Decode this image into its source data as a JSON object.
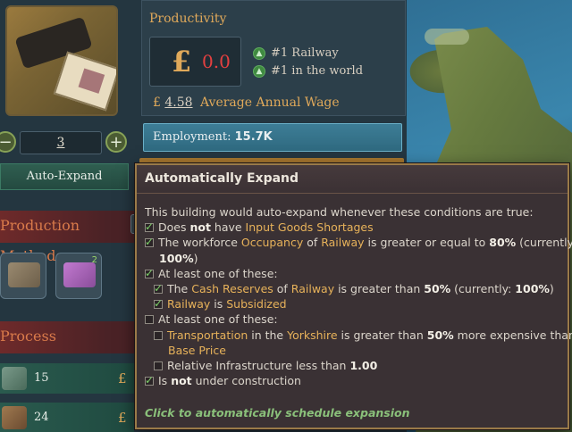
{
  "productivity": {
    "title": "Productivity",
    "currency": "£",
    "value": "0.0",
    "rank_railway": "#1 Railway",
    "rank_world": "#1 in the world",
    "wage_currency": "£",
    "wage_value": "4.58",
    "wage_label": "Average Annual Wage"
  },
  "levels": {
    "value": "3"
  },
  "employment": {
    "label": "Employment:",
    "value": "15.7K"
  },
  "auto_expand": {
    "label": "Auto-Expand"
  },
  "sections": {
    "production_methods": "Production Methods",
    "process": "Process"
  },
  "pm_chip_badge": "2",
  "side_button": "◆",
  "resources": [
    {
      "amount": "15",
      "currency": "£"
    },
    {
      "amount": "24",
      "currency": "£"
    }
  ],
  "tooltip": {
    "title": "Automatically Expand",
    "intro": "This building would auto-expand whenever these conditions are true:",
    "c1": {
      "pre": "Does ",
      "bold": "not",
      "mid": " have ",
      "hl": "Input Goods Shortages"
    },
    "c2": {
      "pre": "The workforce ",
      "hl1": "Occupancy",
      "mid1": " of ",
      "hl2": "Railway",
      "mid2": " is greater or equal to ",
      "b1": "80%",
      "tail": " (currently:",
      "b2": "100%",
      "close": ")"
    },
    "c3": "At least one of these:",
    "c3a": {
      "pre": "The ",
      "hl1": "Cash Reserves",
      "mid1": " of ",
      "hl2": "Railway",
      "mid2": " is greater than ",
      "b1": "50%",
      "tail": " (currently: ",
      "b2": "100%",
      "close": ")"
    },
    "c3b": {
      "hl1": "Railway",
      "mid": " is ",
      "hl2": "Subsidized"
    },
    "c4": "At least one of these:",
    "c4a": {
      "hl1": "Transportation",
      "mid1": " in the ",
      "hl2": "Yorkshire",
      "mid2": " is greater than ",
      "b1": "50%",
      "tail": " more expensive than",
      "hl3": "Base Price"
    },
    "c4b": {
      "pre": "Relative Infrastructure less than ",
      "b": "1.00"
    },
    "c5": {
      "pre": "Is ",
      "bold": "not",
      "tail": " under construction"
    },
    "footer": "Click to automatically schedule expansion"
  },
  "colors": {
    "accent_gold": "#e0a95a",
    "negative_red": "#e34040",
    "check_green": "#7fd26a",
    "footer_green": "#8ac07a"
  }
}
